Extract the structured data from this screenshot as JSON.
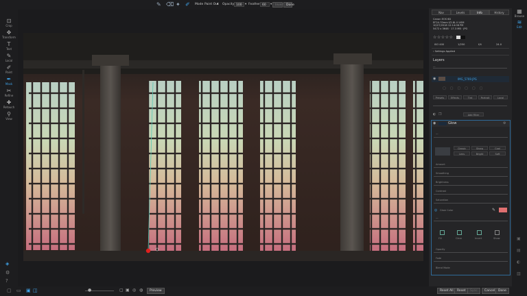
{
  "toolbar": {
    "mode_label": "Mode",
    "mode_value": "Paint Out",
    "opacity_label": "Opacity",
    "opacity_value": "100",
    "feather_label": "Feather",
    "feather_value": "60",
    "invert_label": "Invert",
    "done_label": "Done",
    "icons": [
      "brush-icon",
      "eraser-icon",
      "magic-brush-icon",
      "line-mask-icon"
    ]
  },
  "left_tools": [
    {
      "label": "Crop",
      "icon": "crop-icon",
      "glyph": "⊡",
      "active": false
    },
    {
      "label": "Transform",
      "icon": "transform-icon",
      "glyph": "✥",
      "active": false
    },
    {
      "label": "Text",
      "icon": "text-icon",
      "glyph": "T",
      "active": false
    },
    {
      "label": "Local",
      "icon": "local-brush-icon",
      "glyph": "✎",
      "active": false
    },
    {
      "label": "Paint",
      "icon": "paint-icon",
      "glyph": "✐",
      "active": false
    },
    {
      "label": "Mask",
      "icon": "mask-icon",
      "glyph": "✒",
      "active": true
    },
    {
      "label": "Refine",
      "icon": "refine-icon",
      "glyph": "✂",
      "active": false
    },
    {
      "label": "Retouch",
      "icon": "retouch-icon",
      "glyph": "✚",
      "active": false
    },
    {
      "label": "View",
      "icon": "view-icon",
      "glyph": "⚲",
      "active": false
    }
  ],
  "right_strip": [
    {
      "label": "Browse",
      "icon": "browse-icon",
      "glyph": "▦",
      "active": false
    },
    {
      "label": "Edit",
      "icon": "edit-icon",
      "glyph": "≋",
      "active": true
    }
  ],
  "panel": {
    "tabs": [
      "Nav",
      "Levels",
      "Info",
      "History"
    ],
    "selected_tab": "Info",
    "info_lines": [
      "Canon EOS 6D",
      "EF24-70mm f/2.8L II USM",
      "10/27/2018 12:14:08 PM",
      "5472 x 3648 · 17.3 MB · JPG"
    ],
    "stats": [
      "ISO 400",
      "1/250",
      "f/4",
      "24.0"
    ],
    "settings_applied": "Settings Applied",
    "layers_title": "Layers",
    "layer_file": "IMG_5769.JPG",
    "action_buttons": [
      "Presets",
      "Effects",
      "Tint",
      "Portrait",
      "Local"
    ],
    "add_filter": "Add Filter",
    "filter_title": "Glow",
    "glow_types": [
      "Classic",
      "Sharp",
      "Cool",
      "Lens",
      "Bright",
      "Soft"
    ],
    "sliders": [
      "Amount",
      "Smoothing",
      "Brightness",
      "Contrast",
      "Saturation"
    ],
    "color_label": "Glow Color",
    "color_value": "#e07070",
    "mask_buttons": [
      "Fill",
      "Clear",
      "Invert",
      "Show"
    ],
    "bottom_sliders": [
      "Opacity",
      "Fade",
      "Blend Mode"
    ]
  },
  "bottom": {
    "preview_label": "Preview",
    "reset_all_label": "Reset All",
    "reset_label": "Reset",
    "sync_label": "Sync",
    "cancel_label": "Cancel",
    "done_label": "Done"
  },
  "colors": {
    "accent": "#3fa3e8",
    "panel_bg": "#252527",
    "app_bg": "#1b1b1d",
    "glow_swatch": "#e07070"
  }
}
